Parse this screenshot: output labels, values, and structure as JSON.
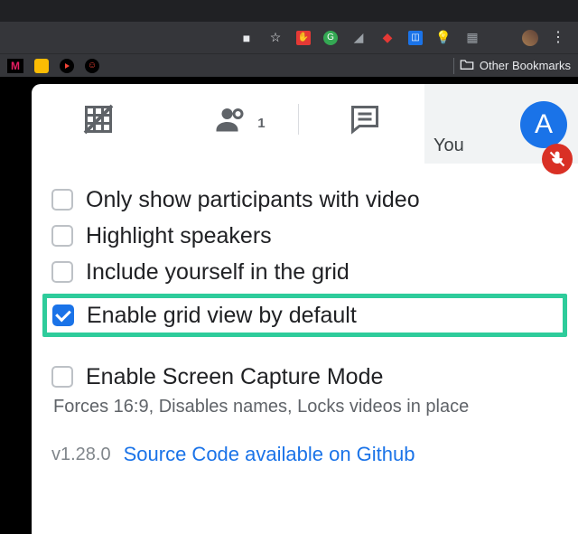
{
  "bookmarks": {
    "other_label": "Other Bookmarks"
  },
  "you_tile": {
    "label": "You",
    "initial": "A"
  },
  "people_badge": "1",
  "options": [
    {
      "label": "Only show participants with video",
      "checked": false,
      "highlight": false
    },
    {
      "label": "Highlight speakers",
      "checked": false,
      "highlight": false
    },
    {
      "label": "Include yourself in the grid",
      "checked": false,
      "highlight": false
    },
    {
      "label": "Enable grid view by default",
      "checked": true,
      "highlight": true
    }
  ],
  "capture": {
    "label": "Enable Screen Capture Mode",
    "desc": "Forces 16:9, Disables names, Locks videos in place"
  },
  "footer": {
    "version": "v1.28.0",
    "link": "Source Code available on Github"
  }
}
